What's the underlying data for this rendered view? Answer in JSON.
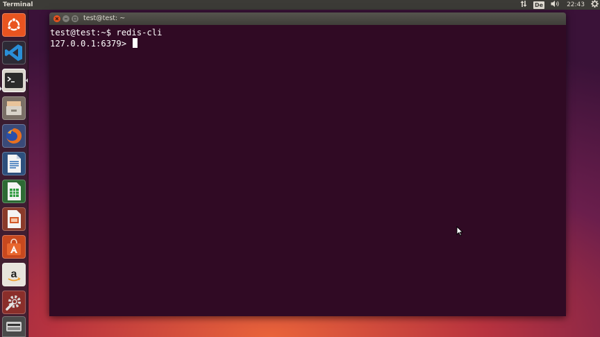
{
  "top_panel": {
    "app_title": "Terminal",
    "keyboard_layout": "De",
    "clock": "22:43",
    "icons": [
      "network-updown-icon",
      "volume-icon",
      "gear-icon"
    ]
  },
  "launcher": {
    "items": [
      {
        "name": "dash-home",
        "icon": "ubuntu-logo-icon"
      },
      {
        "name": "visual-studio-code",
        "icon": "vscode-icon"
      },
      {
        "name": "terminal",
        "icon": "terminal-icon",
        "active": true
      },
      {
        "name": "files",
        "icon": "file-cabinet-icon"
      },
      {
        "name": "firefox",
        "icon": "firefox-icon"
      },
      {
        "name": "libreoffice-writer",
        "icon": "writer-document-icon"
      },
      {
        "name": "libreoffice-calc",
        "icon": "calc-spreadsheet-icon"
      },
      {
        "name": "libreoffice-impress",
        "icon": "impress-presentation-icon"
      },
      {
        "name": "software-center",
        "icon": "shopping-bag-icon"
      },
      {
        "name": "amazon",
        "icon": "amazon-icon"
      },
      {
        "name": "system-settings",
        "icon": "wrench-gear-icon"
      },
      {
        "name": "dvd",
        "icon": "dvd-icon"
      }
    ]
  },
  "window": {
    "title": "test@test: ~",
    "terminal_lines": [
      "test@test:~$ redis-cli",
      "127.0.0.1:6379> "
    ]
  },
  "colors": {
    "terminal_bg": "#300a24",
    "panel_bg": "#3c3b37",
    "close_button": "#e95420"
  }
}
